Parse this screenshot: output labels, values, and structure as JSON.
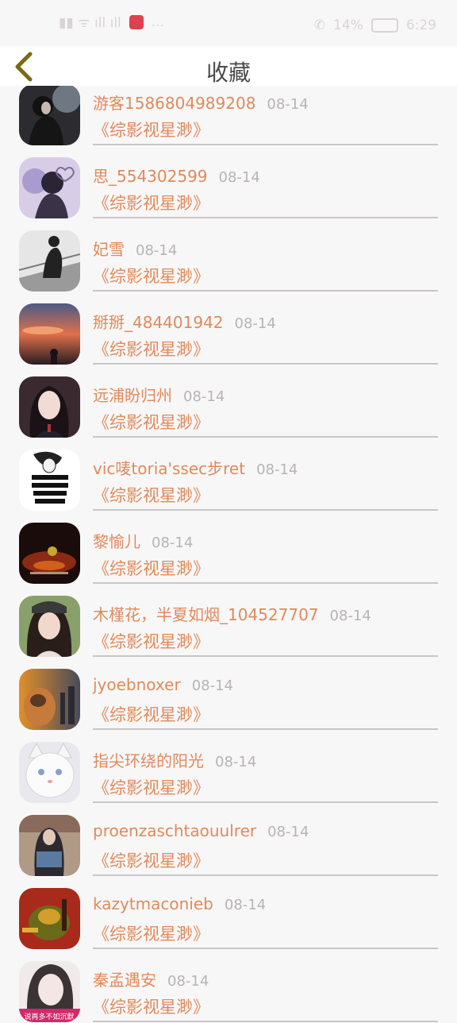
{
  "status_bar": {
    "left_text": "...",
    "battery_text": "14%",
    "time": "6:29"
  },
  "header": {
    "title": "收藏"
  },
  "colors": {
    "accent": "#e08a5a",
    "muted": "#b7b3b6",
    "back_icon": "#7a6a12"
  },
  "favorites": [
    {
      "user": "游客1586804989208",
      "date": "08-14",
      "book": "《综影视星渺》",
      "avatar": "avatar-dark-girl"
    },
    {
      "user": "思_554302599",
      "date": "08-14",
      "book": "《综影视星渺》",
      "avatar": "avatar-purple-girl"
    },
    {
      "user": "妃雪",
      "date": "08-14",
      "book": "《综影视星渺》",
      "avatar": "avatar-rail-girl"
    },
    {
      "user": "掰掰_484401942",
      "date": "08-14",
      "book": "《综影视星渺》",
      "avatar": "avatar-sunset"
    },
    {
      "user": "远浦盼归州",
      "date": "08-14",
      "book": "《综影视星渺》",
      "avatar": "avatar-girl-portrait"
    },
    {
      "user": "vic唛toria'ssec步ret",
      "date": "08-14",
      "book": "《综影视星渺》",
      "avatar": "avatar-sketch"
    },
    {
      "user": "黎愉儿",
      "date": "08-14",
      "book": "《综影视星渺》",
      "avatar": "avatar-dark-red"
    },
    {
      "user": "木槿花，半夏如烟_104527707",
      "date": "08-14",
      "book": "《综影视星渺》",
      "avatar": "avatar-girl-cap"
    },
    {
      "user": "jyoebnoxer",
      "date": "08-14",
      "book": "《综影视星渺》",
      "avatar": "avatar-pug-city"
    },
    {
      "user": "指尖环绕的阳光",
      "date": "08-14",
      "book": "《综影视星渺》",
      "avatar": "avatar-white-cat"
    },
    {
      "user": "proenzaschtaouulrer",
      "date": "08-14",
      "book": "《综影视星渺》",
      "avatar": "avatar-school-girl"
    },
    {
      "user": "kazytmaconieb",
      "date": "08-14",
      "book": "《综影视星渺》",
      "avatar": "avatar-game-char"
    },
    {
      "user": "秦孟遇安",
      "date": "08-14",
      "book": "《综影视星渺》",
      "avatar": "avatar-quote"
    }
  ],
  "last_avatar_caption": "说再多不如沉默"
}
